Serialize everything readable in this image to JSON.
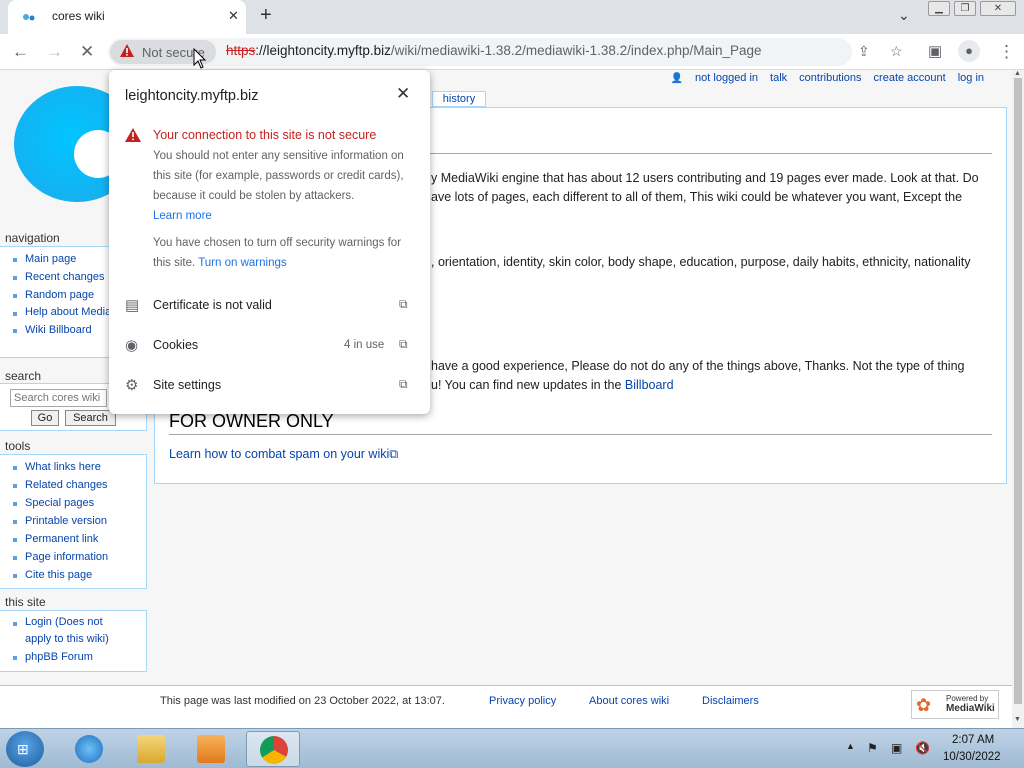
{
  "browser": {
    "tab_title": "cores wiki",
    "new_tab_glyph": "+",
    "close_glyph": "✕",
    "omnibox": {
      "security_chip_label": "Not secure",
      "url_scheme": "https",
      "url_host": "://leightoncity.myftp.biz",
      "url_path": "/wiki/mediawiki-1.38.2/mediawiki-1.38.2/index.php/Main_Page"
    }
  },
  "security_popup": {
    "host": "leightoncity.myftp.biz",
    "warning_title": "Your connection to this site is not secure",
    "warning_text": "You should not enter any sensitive information on this site (for example, passwords or credit cards), because it could be stolen by attackers.",
    "learn_more": "Learn more",
    "chosen_text": "You have chosen to turn off security warnings for this site.",
    "turn_on_warnings": "Turn on warnings",
    "rows": [
      {
        "label": "Certificate is not valid",
        "badge": ""
      },
      {
        "label": "Cookies",
        "badge": "4 in use"
      },
      {
        "label": "Site settings",
        "badge": ""
      }
    ]
  },
  "wiki": {
    "personal_tools": [
      "not logged in",
      "talk",
      "contributions",
      "create account",
      "log in"
    ],
    "history_tab": "history",
    "content_lines": [
      "y MediaWiki engine that has about 12 users contributing and 19 pages ever made. Look at that. Do",
      "ave lots of pages, each different to all of them, This wiki could be whatever you want, Except the",
      ", orientation, identity, skin color, body shape, education, purpose, daily habits, ethnicity, nationality",
      "have a good experience, Please do not do any of the things above, Thanks. Not the type of thing"
    ],
    "billboard_prefix": "u! You can find new updates in the ",
    "billboard_link": "Billboard",
    "owner_heading": "FOR OWNER ONLY",
    "spam_link": "Learn how to combat spam on your wiki",
    "navigation": {
      "heading": "navigation",
      "items": [
        "Main page",
        "Recent changes",
        "Random page",
        "Help about MediaWiki",
        "Wiki Billboard"
      ]
    },
    "search": {
      "heading": "search",
      "placeholder": "Search cores wiki",
      "go": "Go",
      "search": "Search"
    },
    "tools": {
      "heading": "tools",
      "items": [
        "What links here",
        "Related changes",
        "Special pages",
        "Printable version",
        "Permanent link",
        "Page information",
        "Cite this page"
      ]
    },
    "this_site": {
      "heading": "this site",
      "items": [
        "Login (Does not apply to this wiki)",
        "phpBB Forum"
      ]
    },
    "footer": {
      "last_modified": "This page was last modified on 23 October 2022, at 13:07.",
      "links": [
        "Privacy policy",
        "About cores wiki",
        "Disclaimers"
      ],
      "powered_small": "Powered by",
      "powered_big": "MediaWiki"
    }
  },
  "taskbar": {
    "time": "2:07 AM",
    "date": "10/30/2022"
  }
}
